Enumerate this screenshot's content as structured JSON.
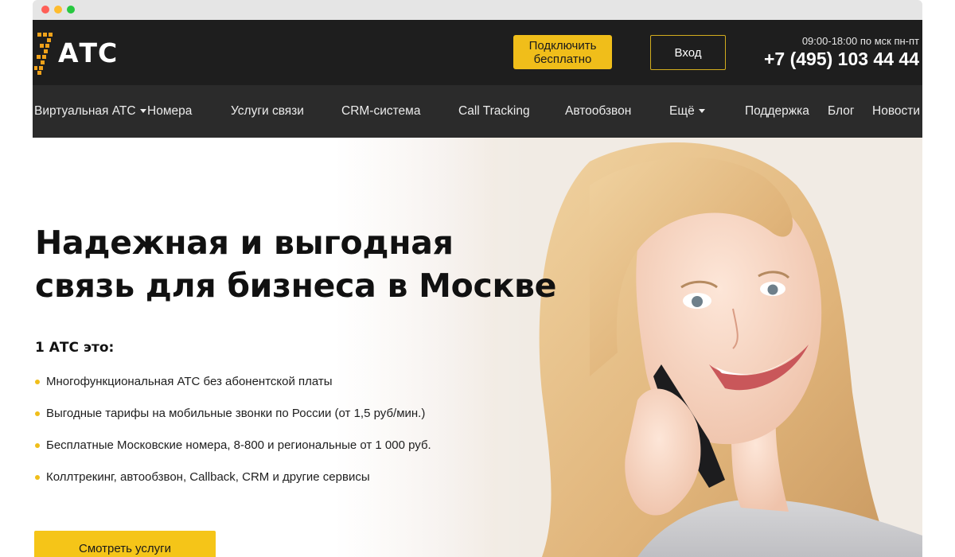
{
  "header": {
    "logo_text": "АТС",
    "cta_label": "Подключить бесплатно",
    "login_label": "Вход",
    "hours": "09:00-18:00 по мск пн-пт",
    "phone": "+7 (495) 103 44 44"
  },
  "nav": {
    "items": [
      {
        "label": "Виртуальная АТС",
        "dropdown": true
      },
      {
        "label": "Номера"
      },
      {
        "label": "Услуги связи"
      },
      {
        "label": "CRM-система"
      },
      {
        "label": "Call Tracking"
      },
      {
        "label": "Автообзвон"
      },
      {
        "label": "Ещё",
        "dropdown": true
      },
      {
        "label": "Поддержка"
      },
      {
        "label": "Блог"
      },
      {
        "label": "Новости"
      }
    ]
  },
  "hero": {
    "headline_line1": "Надежная и выгодная",
    "headline_line2": "связь для бизнеса в Москве",
    "subhead": "1 АТС это:",
    "features": [
      "Многофункциональная АТС без абонентской платы",
      "Выгодные тарифы на мобильные звонки по России (от 1,5 руб/мин.)",
      "Бесплатные Московские номера, 8-800 и региональные от 1 000 руб.",
      "Коллтрекинг, автообзвон, Callback, CRM и другие сервисы"
    ],
    "button_label": "Смотреть услуги"
  },
  "colors": {
    "accent": "#f0be1a",
    "header_bg": "#1e1e1e",
    "nav_bg": "#2b2b2b"
  }
}
